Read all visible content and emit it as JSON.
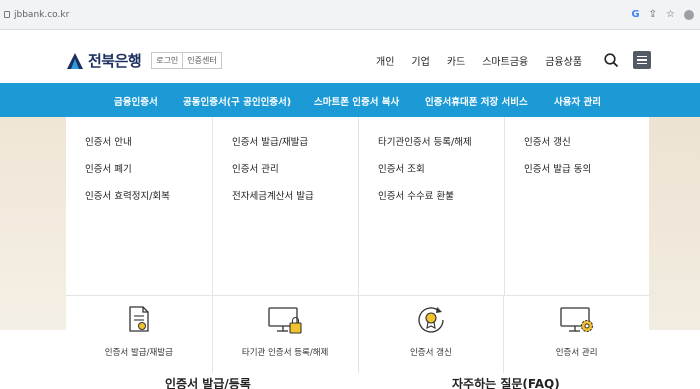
{
  "browser": {
    "url": "jbbank.co.kr",
    "toolbar_icons": [
      "google-icon",
      "share-icon",
      "star-icon",
      "profile-icon"
    ]
  },
  "header": {
    "logo_name": "전북은행",
    "logo_sub": [
      "로그인",
      "인증센터"
    ],
    "nav": [
      "개인",
      "기업",
      "카드",
      "스마트금융",
      "금융상품"
    ]
  },
  "gnb": {
    "items": [
      "금융인증서",
      "공동인증서(구 공인인증서)",
      "스마트폰 인증서 복사",
      "인증서휴대폰 저장 서비스",
      "사용자 관리"
    ]
  },
  "mega": {
    "columns": [
      [
        "인증서 안내",
        "인증서 폐기",
        "인증서 효력정지/회복"
      ],
      [
        "인증서 발급/재발급",
        "인증서 관리",
        "전자세금계산서 발급"
      ],
      [
        "타기관인증서 등록/해제",
        "인증서 조회",
        "인증서 수수료 환불"
      ],
      [
        "인증서 갱신",
        "인증서 발급 동의"
      ]
    ]
  },
  "quick": [
    {
      "label": "인증서 발급/재발급",
      "icon": "certificate-document-icon"
    },
    {
      "label": "타기관 인증서 등록/해제",
      "icon": "monitor-lock-icon"
    },
    {
      "label": "인증서 갱신",
      "icon": "certificate-renew-icon"
    },
    {
      "label": "인증서 관리",
      "icon": "monitor-gear-icon"
    }
  ],
  "bottom": {
    "left_title": "인증서 발급/등록",
    "right_title": "자주하는 질문(FAQ)"
  },
  "colors": {
    "gnb": "#1b9ad6",
    "accent_yellow": "#f2c12e",
    "brand_navy": "#1d2f5e"
  }
}
